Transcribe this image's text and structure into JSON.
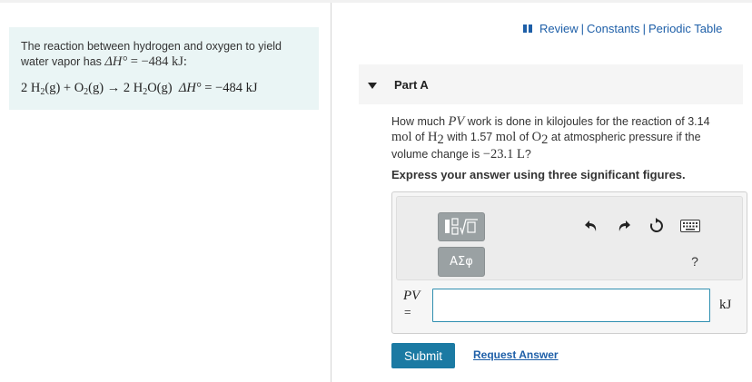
{
  "intro": {
    "text_before": "The reaction between hydrogen and oxygen to yield water vapor has",
    "delta_h_symbol": "ΔH°",
    "delta_h_value": "= −484 kJ:",
    "reaction": {
      "h2_coef": "2 H",
      "h2_sub": "2",
      "h2_state": "(g) + O",
      "o2_sub": "2",
      "o2_state": "(g) → 2 H",
      "h2o_sub": "2",
      "h2o_state": "O(g)",
      "dh_symbol": "ΔH°",
      "dh_value": "= −484 kJ"
    }
  },
  "header": {
    "review": "Review",
    "constants": "Constants",
    "periodic_table": "Periodic Table",
    "separator": "|"
  },
  "part": {
    "title": "Part A"
  },
  "question": {
    "t1": "How much",
    "pv": "PV",
    "t2": "work is done in kilojoules for the reaction of 3.14",
    "mol1": "mol",
    "t3": "of",
    "h2": "H",
    "h2_sub": "2",
    "t4": "with 1.57",
    "mol2": "mol",
    "t5": "of",
    "o2": "O",
    "o2_sub": "2",
    "t6": "at atmospheric pressure if the volume change is",
    "volume": "−23.1 L",
    "t7": "?"
  },
  "instruction": "Express your answer using three significant figures.",
  "answer": {
    "pv_label": "PV",
    "eq_label": "=",
    "value": "",
    "unit": "kJ",
    "greek_label": "ΑΣφ",
    "help_label": "?"
  },
  "toolbar_icons": [
    "templates-icon",
    "undo-icon",
    "redo-icon",
    "reset-icon",
    "keyboard-icon"
  ],
  "actions": {
    "submit": "Submit",
    "request": "Request Answer"
  },
  "colors": {
    "link": "#1e5fa8",
    "intro_bg": "#eaf5f5",
    "submit_bg": "#1b7aa3",
    "input_border": "#2f8fb0"
  }
}
